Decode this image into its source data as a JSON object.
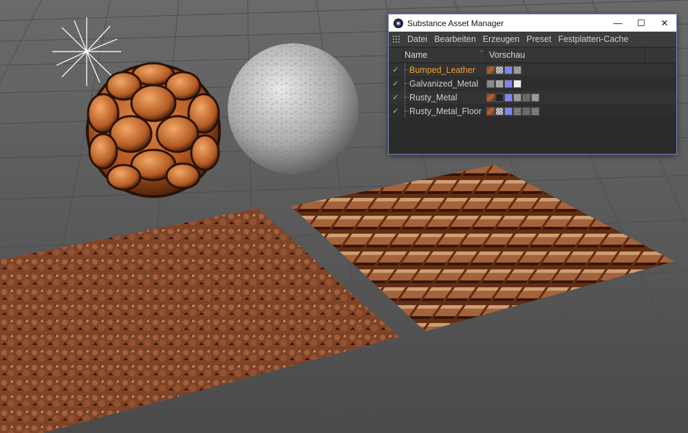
{
  "window": {
    "title": "Substance Asset Manager",
    "controls": {
      "minimize": "—",
      "maximize": "☐",
      "close": "✕"
    }
  },
  "menu": {
    "items": [
      "Datei",
      "Bearbeiten",
      "Erzeugen",
      "Preset",
      "Festplatten-Cache"
    ]
  },
  "table": {
    "columns": {
      "name": "Name",
      "preview": "Vorschau"
    },
    "rows": [
      {
        "check": "✓",
        "name": "Bumped_Leather",
        "selected": true,
        "swatches": [
          "rust",
          "check",
          "blue",
          "noise"
        ]
      },
      {
        "check": "✓",
        "name": "Galvanized_Metal",
        "selected": false,
        "swatches": [
          "gray",
          "lgray",
          "blue",
          "white"
        ]
      },
      {
        "check": "✓",
        "name": "Rusty_Metal",
        "selected": false,
        "swatches": [
          "rust",
          "dark",
          "blue",
          "noise",
          "dgray",
          "noise"
        ]
      },
      {
        "check": "✓",
        "name": "Rusty_Metal_Floor",
        "selected": false,
        "swatches": [
          "rust",
          "check",
          "blue",
          "dots",
          "dgray",
          "dots"
        ]
      }
    ]
  },
  "colors": {
    "selected_text": "#f0a030",
    "window_border": "#7a8cc4",
    "viewport_bg": "#5f5f5f"
  }
}
